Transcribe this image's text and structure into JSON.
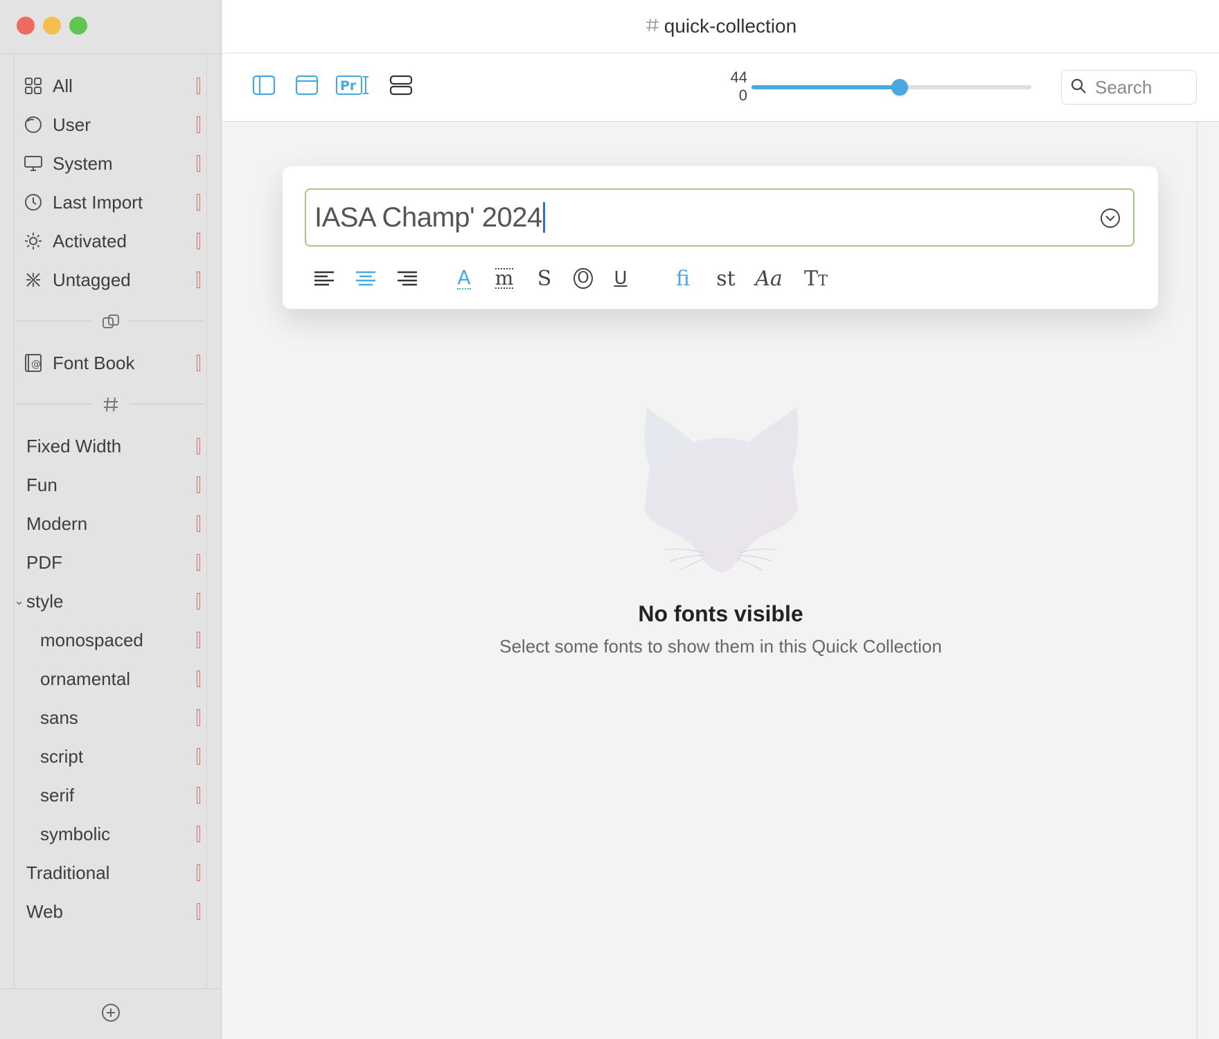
{
  "window": {
    "title": "quick-collection",
    "title_icon": "hash-icon",
    "controls": [
      "close",
      "minimize",
      "zoom"
    ]
  },
  "sidebar": {
    "library_items": [
      {
        "label": "All",
        "icon": "grid-icon"
      },
      {
        "label": "User",
        "icon": "user-icon"
      },
      {
        "label": "System",
        "icon": "display-icon"
      },
      {
        "label": "Last Import",
        "icon": "clock-icon"
      },
      {
        "label": "Activated",
        "icon": "sun-icon"
      },
      {
        "label": "Untagged",
        "icon": "untagged-icon"
      }
    ],
    "collections_divider_icon": "link-icon",
    "collection_items": [
      {
        "label": "Font Book",
        "icon": "at-book-icon"
      }
    ],
    "tags_divider_icon": "hash-icon",
    "tag_items": [
      {
        "label": "Fixed Width"
      },
      {
        "label": "Fun"
      },
      {
        "label": "Modern"
      },
      {
        "label": "PDF"
      },
      {
        "label": "style"
      },
      {
        "label": "monospaced"
      },
      {
        "label": "ornamental"
      },
      {
        "label": "sans"
      },
      {
        "label": "script"
      },
      {
        "label": "serif"
      },
      {
        "label": "symbolic"
      },
      {
        "label": "Traditional"
      },
      {
        "label": "Web"
      }
    ],
    "expanded_tag": "style",
    "footer_icon": "add-circle-icon"
  },
  "toolbar": {
    "buttons": [
      "sidebar-toggle-icon",
      "window-icon",
      "preview-text-icon",
      "list-view-icon"
    ],
    "size_value": "44",
    "count_value": "0",
    "slider_fraction": 0.53,
    "search_placeholder": "Search"
  },
  "sample": {
    "text": "IASA Champ' 2024",
    "format_icons": [
      "align-left-icon",
      "align-center-icon",
      "align-right-icon",
      "tracking-icon",
      "baseline-icon",
      "stylistic-s-icon",
      "ordinal-icon",
      "underline-icon",
      "ligature-icon",
      "st-ligature-icon",
      "swash-icon",
      "small-caps-icon"
    ],
    "ligature_glyph": "fi",
    "st_glyph": "st",
    "swash_glyph": "Aa",
    "caps_glyph": "Tt",
    "underline_glyph": "U",
    "ordinal_glyph": "O",
    "baseline_glyph": "m",
    "tracking_glyph": "A",
    "stylistic_glyph": "S"
  },
  "empty_state": {
    "title": "No fonts visible",
    "subtitle": "Select some fonts to show them in this Quick Collection",
    "image": "fox-head-icon"
  },
  "colors": {
    "accent": "#4aa8e0",
    "field_border": "#a6c97d",
    "close": "#ec6a5e",
    "minimize": "#f4bf4f",
    "zoom": "#61c554"
  }
}
